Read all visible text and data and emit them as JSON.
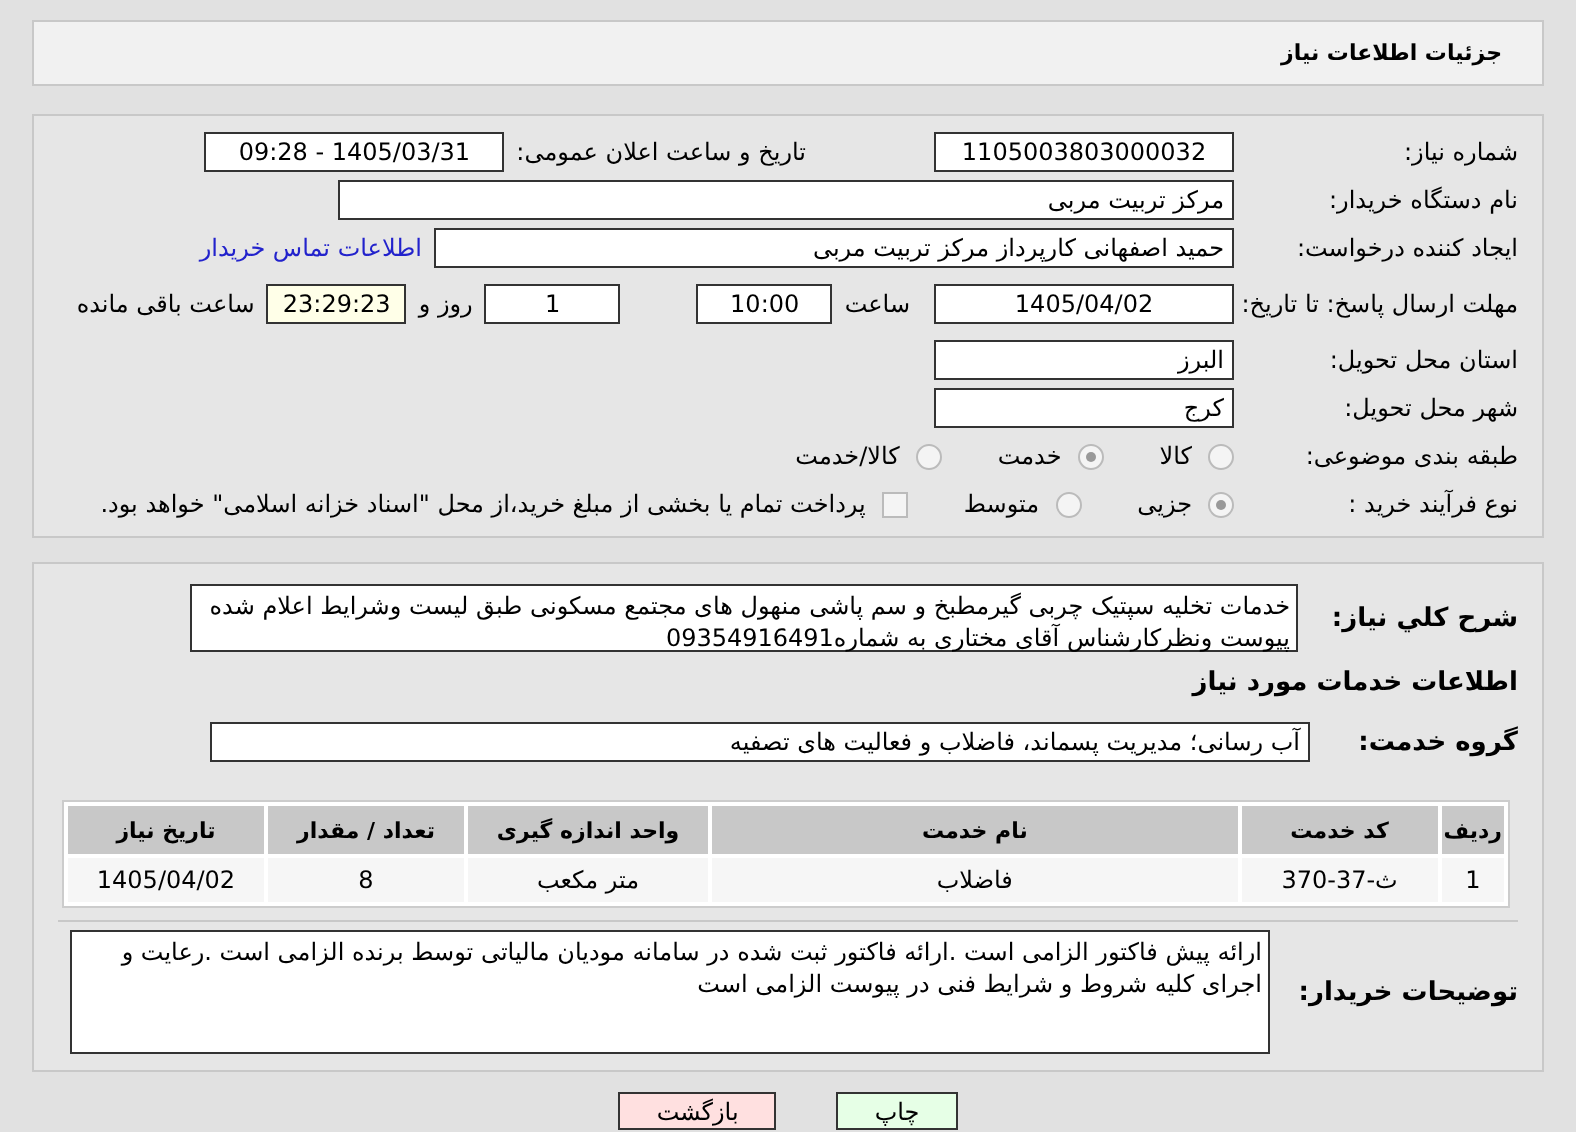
{
  "header": {
    "title": "جزئیات اطلاعات نیاز"
  },
  "need_number": {
    "label": "شماره نیاز:",
    "value": "1105003803000032"
  },
  "announce": {
    "label": "تاریخ و ساعت اعلان عمومی:",
    "value": "1405/03/31 - 09:28"
  },
  "buyer": {
    "label": "نام دستگاه خریدار:",
    "value": "مرکز تربیت مربی"
  },
  "creator": {
    "label": "ایجاد کننده درخواست:",
    "value": "حمید اصفهانی کارپرداز مرکز تربیت مربی",
    "link": "اطلاعات تماس خریدار"
  },
  "deadline": {
    "label": "مهلت ارسال پاسخ: تا تاریخ:",
    "date": "1405/04/02",
    "time_label": "ساعت",
    "time": "10:00",
    "days": "1",
    "days_label": "روز و",
    "remaining": "23:29:23",
    "remaining_label": "ساعت باقی مانده"
  },
  "province": {
    "label": "استان محل تحویل:",
    "value": "البرز"
  },
  "city": {
    "label": "شهر محل تحویل:",
    "value": "کرج"
  },
  "category": {
    "label": "طبقه بندی موضوعی:",
    "options": [
      {
        "label": "کالا",
        "selected": false
      },
      {
        "label": "خدمت",
        "selected": true
      },
      {
        "label": "کالا/خدمت",
        "selected": false
      }
    ]
  },
  "process": {
    "label": "نوع فرآیند خرید :",
    "options": [
      {
        "label": "جزیی",
        "selected": true
      },
      {
        "label": "متوسط",
        "selected": false
      }
    ],
    "payment": {
      "checked": false,
      "text": "پرداخت تمام یا بخشی از مبلغ خرید،از محل \"اسناد خزانه اسلامی\" خواهد بود."
    }
  },
  "description": {
    "label": "شرح کلي نياز:",
    "value": "خدمات تخلیه سپتیک چربی گیرمطبخ و سم پاشی منهول های مجتمع مسکونی طبق لیست وشرایط اعلام شده پیوست ونظرکارشناس آقای مختاری به شماره09354916491"
  },
  "services_heading": "اطلاعات خدمات مورد نیاز",
  "service_group": {
    "label": "گروه خدمت:",
    "value": "آب رسانی؛ مدیریت پسماند، فاضلاب و فعالیت های تصفیه"
  },
  "table": {
    "columns": [
      "ردیف",
      "کد خدمت",
      "نام خدمت",
      "واحد اندازه گیری",
      "تعداد / مقدار",
      "تاریخ نیاز"
    ],
    "rows": [
      [
        "1",
        "ث-37-370",
        "فاضلاب",
        "متر مکعب",
        "8",
        "1405/04/02"
      ]
    ]
  },
  "buyer_notes": {
    "label": "توضیحات خریدار:",
    "value": "ارائه پیش فاکتور الزامی است .ارائه فاکتور ثبت شده در سامانه مودیان مالیاتی توسط برنده الزامی است .رعایت و اجرای کلیه شروط و شرایط فنی در پیوست الزامی است"
  },
  "buttons": [
    {
      "kind": "print",
      "label": "چاپ"
    },
    {
      "kind": "back",
      "label": "بازگشت"
    }
  ]
}
